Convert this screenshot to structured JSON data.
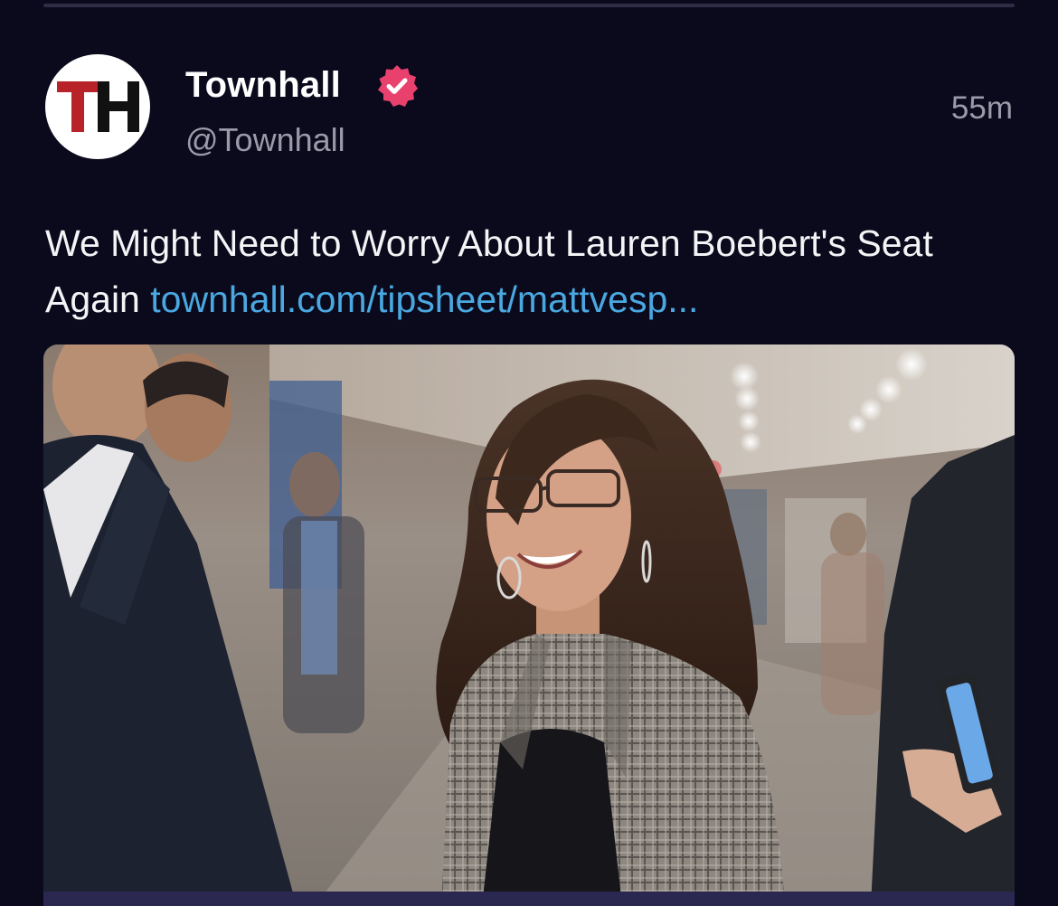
{
  "post": {
    "author": {
      "name": "Townhall",
      "handle": "@Townhall",
      "avatar_text": "TH",
      "verified_icon": "verified-badge-icon"
    },
    "timestamp": "55m",
    "text": "We Might Need to Worry About Lauren Boebert's Seat Again",
    "link_text": "townhall.com/tipsheet/mattvesp..."
  },
  "colors": {
    "background": "#0b0a1d",
    "link": "#4aa8e0",
    "verified_badge": "#e8416e",
    "secondary_text": "#9b9aa8",
    "avatar_red": "#b8232a"
  }
}
